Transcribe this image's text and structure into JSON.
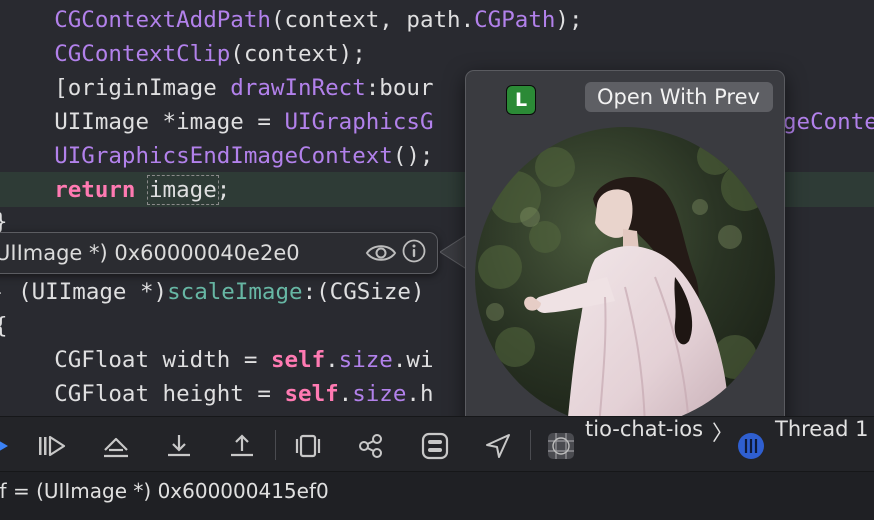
{
  "code_lines": {
    "l1": {
      "fn": "CGContextAddPath",
      "text_a": "(context, path.",
      "member": "CGPath",
      "text_b": ");"
    },
    "l2": {
      "fn": "CGContextClip",
      "text_a": "(context);"
    },
    "l3": {
      "text_a": "[originImage ",
      "fn": "drawInRect",
      "text_b": ":bour"
    },
    "l4": {
      "text_a": "UIImage *image = ",
      "fn": "UIGraphicsG",
      "tail": "geConte"
    },
    "l5": {
      "fn": "UIGraphicsEndImageContext",
      "text_a": "();"
    },
    "l6": {
      "kw": "return",
      "token": "image",
      "text_a": ";"
    },
    "l7": {
      "text_a": "}"
    },
    "l8": {
      "text_a": "- (UIImage *)",
      "method": "scaleImage",
      "text_b": ":(CGSize)"
    },
    "l9": {
      "text_a": "{"
    },
    "l10": {
      "text_a": "CGFloat width = ",
      "kw": "self",
      "dot": ".",
      "member": "size",
      "text_b": ".wi"
    },
    "l11": {
      "text_a": "CGFloat height = ",
      "kw": "self",
      "dot": ".",
      "member": "size",
      "text_b": ".h"
    }
  },
  "debug_tip": {
    "value": "UIImage *) 0x60000040e2e0",
    "eye_icon": "eye-icon",
    "info_icon": "info-icon"
  },
  "quicklook": {
    "badge": "L",
    "open_button": "Open With Prev",
    "image_desc": "circular-photo"
  },
  "toolbar": {
    "target": "tio-chat-ios",
    "separator": "〉",
    "thread": "Thread 1"
  },
  "console": {
    "line": "lf = (UIImage *) 0x600000415ef0"
  },
  "colors": {
    "editor_bg": "#292a30",
    "keyword": "#ff7ab2",
    "function": "#b281eb",
    "method": "#67b7a4",
    "highlight": "#2e3b36",
    "badge": "#2b8a36",
    "toolbar_icon": "#c8c8c8"
  }
}
